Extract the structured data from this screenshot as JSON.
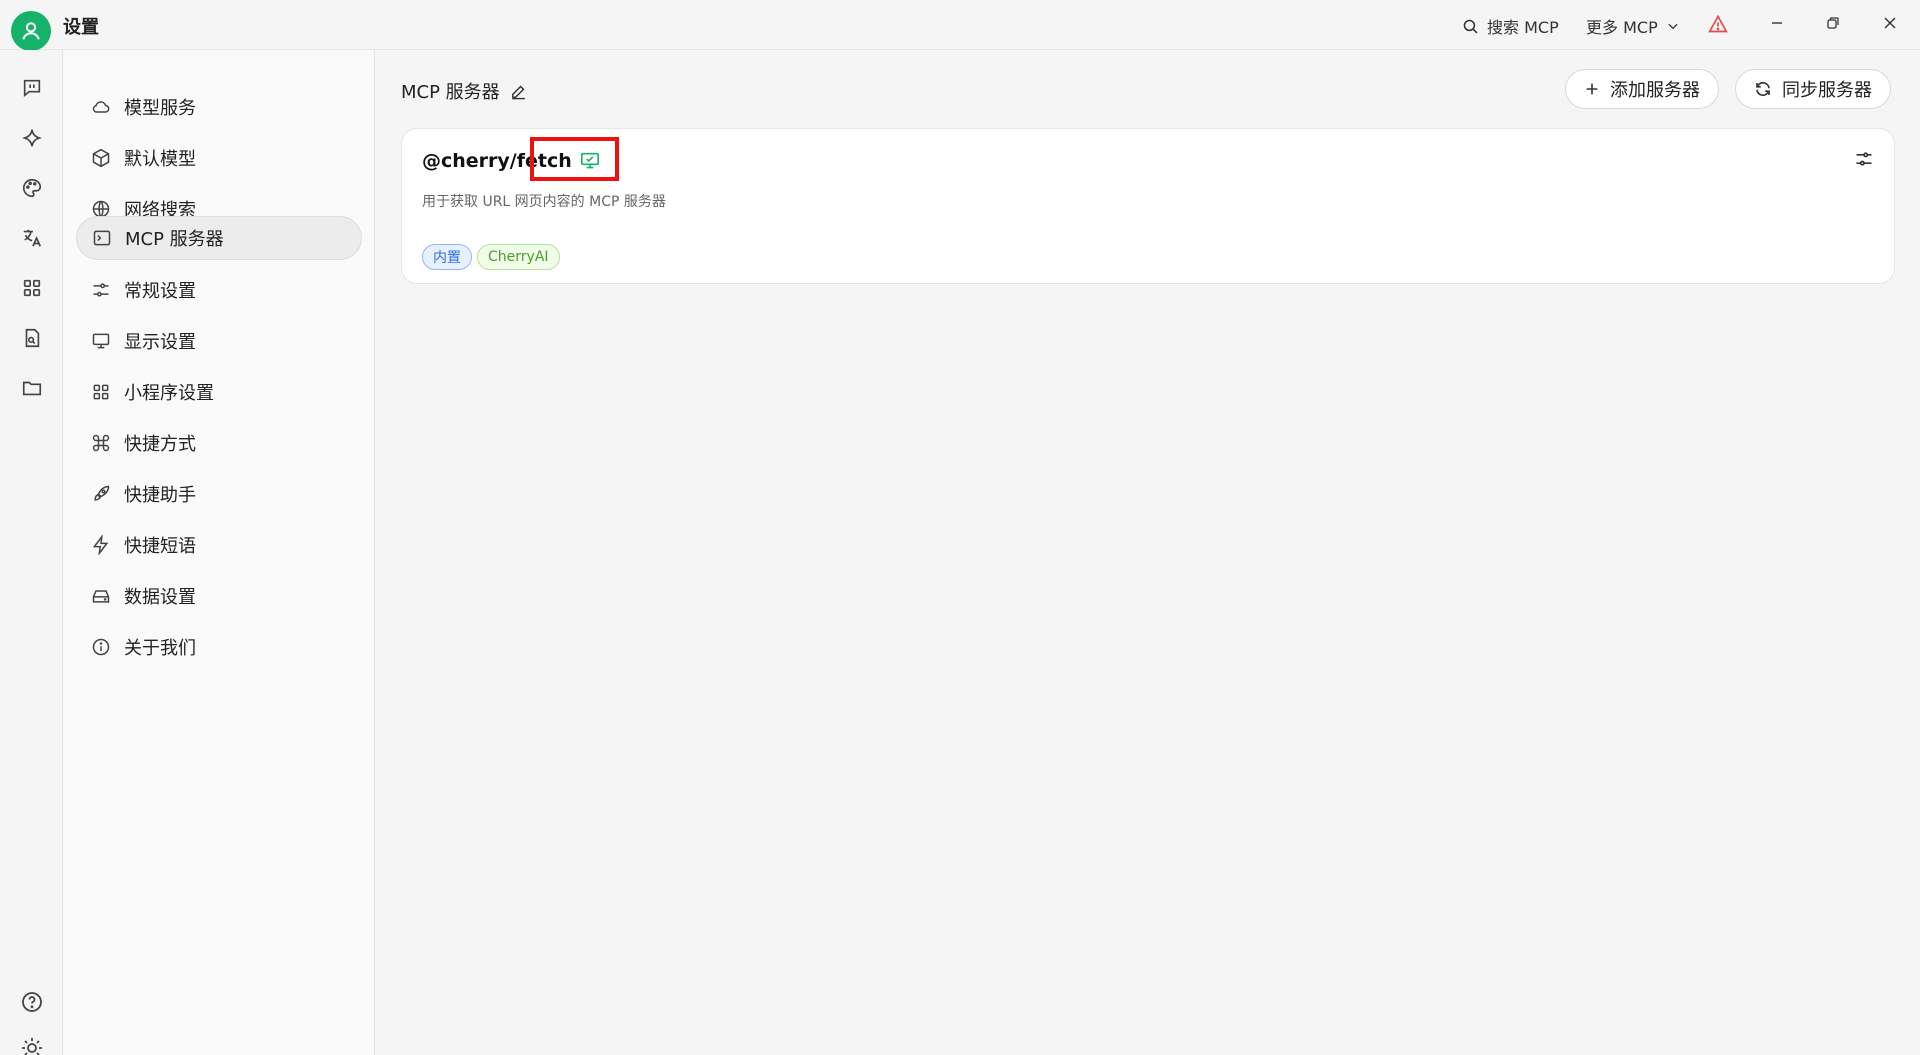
{
  "titlebar": {
    "title": "设置",
    "search_label": "搜索 MCP",
    "more_label": "更多 MCP"
  },
  "nav": {
    "items": [
      {
        "label": "模型服务",
        "icon": "cloud-icon"
      },
      {
        "label": "默认模型",
        "icon": "cube-icon"
      },
      {
        "label": "网络搜索",
        "icon": "globe-icon"
      },
      {
        "label": "MCP 服务器",
        "icon": "terminal-icon"
      },
      {
        "label": "常规设置",
        "icon": "sliders-icon"
      },
      {
        "label": "显示设置",
        "icon": "monitor-icon"
      },
      {
        "label": "小程序设置",
        "icon": "grid-icon"
      },
      {
        "label": "快捷方式",
        "icon": "command-icon"
      },
      {
        "label": "快捷助手",
        "icon": "rocket-icon"
      },
      {
        "label": "快捷短语",
        "icon": "zap-icon"
      },
      {
        "label": "数据设置",
        "icon": "hard-drive-icon"
      },
      {
        "label": "关于我们",
        "icon": "info-icon"
      }
    ],
    "active_index": 3
  },
  "main": {
    "title": "MCP 服务器",
    "add_button": "添加服务器",
    "sync_button": "同步服务器"
  },
  "server": {
    "name": "@cherry/fetch",
    "description": "用于获取 URL 网页内容的 MCP 服务器",
    "tags": [
      "内置",
      "CherryAI"
    ]
  },
  "colors": {
    "accent": "#17b26a",
    "warning": "#e5484d",
    "highlight": "#ee1111"
  }
}
